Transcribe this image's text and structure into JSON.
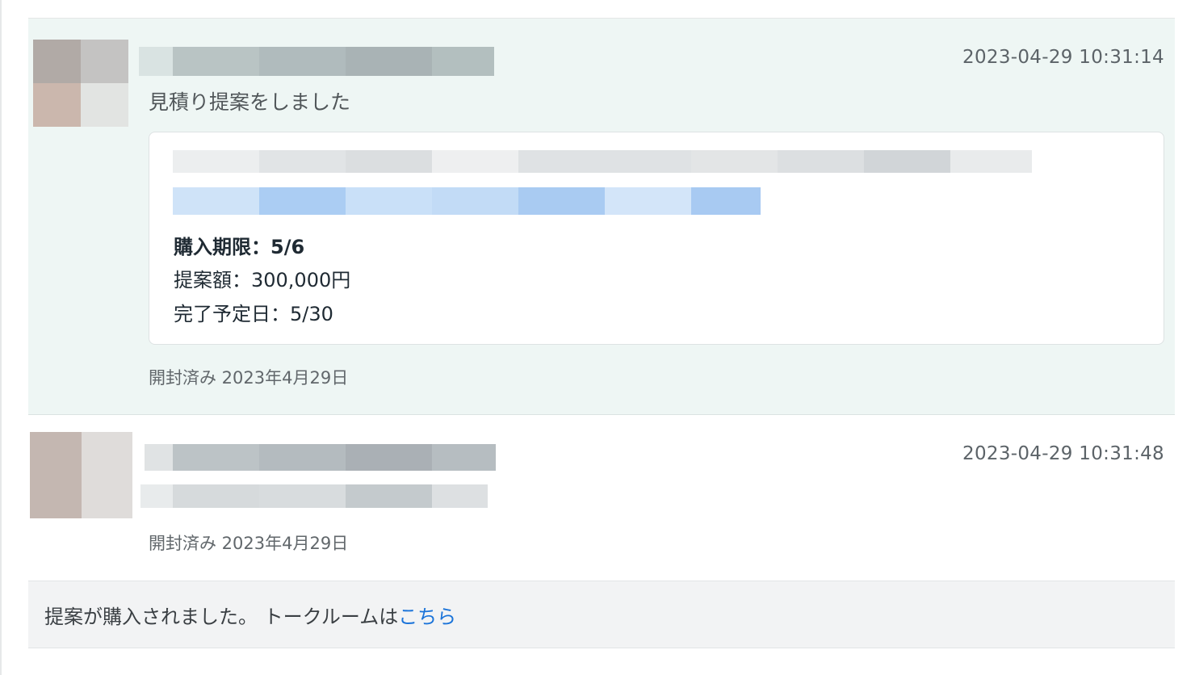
{
  "messages": [
    {
      "timestamp": "2023-04-29 10:31:14",
      "text": "見積り提案をしました",
      "proposal": {
        "deadline": "購入期限：5/6",
        "amount": "提案額：300,000円",
        "completion_date": "完了予定日：5/30"
      },
      "opened": "開封済み 2023年4月29日"
    },
    {
      "timestamp": "2023-04-29 10:31:48",
      "opened": "開封済み 2023年4月29日"
    }
  ],
  "footer": {
    "text": "提案が購入されました。 トークルームは",
    "link": "こちら"
  }
}
